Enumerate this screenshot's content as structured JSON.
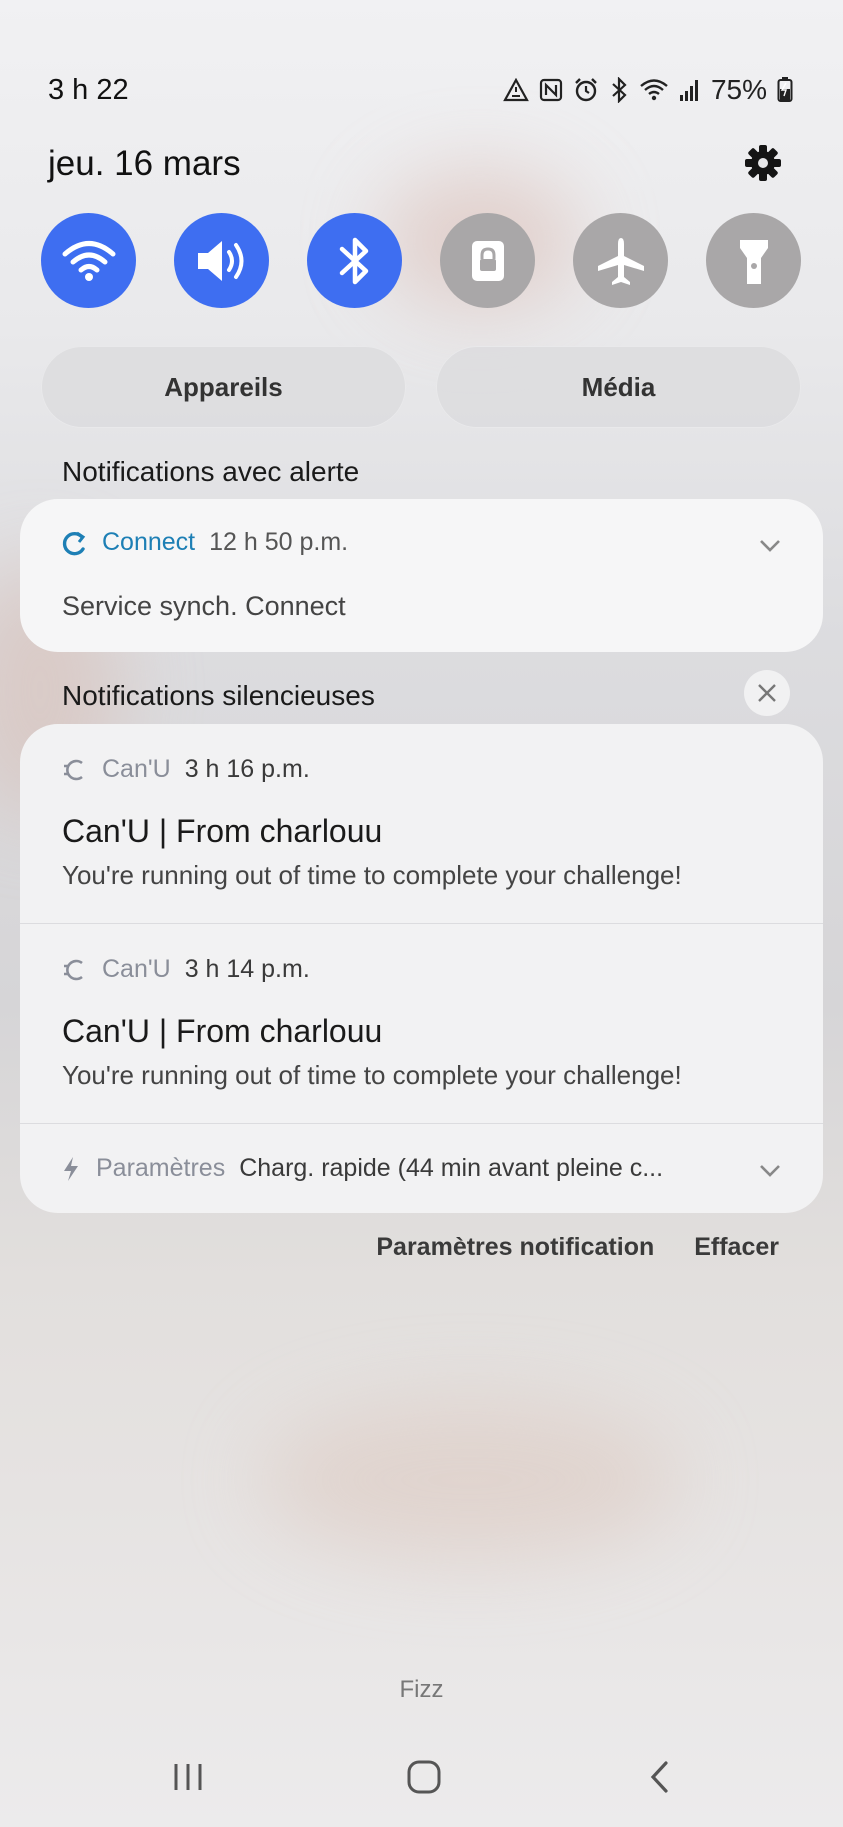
{
  "status_bar": {
    "time": "3 h 22",
    "battery": "75%",
    "icons": [
      "alert-triangle-icon",
      "nfc-icon",
      "alarm-icon",
      "bluetooth-icon",
      "wifi-icon",
      "signal-icon",
      "battery-charging-icon"
    ]
  },
  "date": "jeu. 16 mars",
  "quick_toggles": [
    {
      "name": "wifi",
      "icon": "wifi-icon",
      "state": "on"
    },
    {
      "name": "sound",
      "icon": "volume-icon",
      "state": "on"
    },
    {
      "name": "bluetooth",
      "icon": "bluetooth-icon",
      "state": "on"
    },
    {
      "name": "rotation-lock",
      "icon": "lock-icon",
      "state": "off"
    },
    {
      "name": "airplane",
      "icon": "airplane-icon",
      "state": "off"
    },
    {
      "name": "flashlight",
      "icon": "flashlight-icon",
      "state": "off"
    }
  ],
  "pills": {
    "devices": "Appareils",
    "media": "Média"
  },
  "alert_section": {
    "label": "Notifications avec alerte",
    "notification": {
      "app": "Connect",
      "time": "12 h 50 p.m.",
      "body": "Service synch. Connect"
    }
  },
  "silent_section": {
    "label": "Notifications silencieuses",
    "notifications": [
      {
        "app": "Can'U",
        "time": "3 h 16 p.m.",
        "title": "Can'U | From charlouu",
        "text": "You're running out of time to complete your challenge!"
      },
      {
        "app": "Can'U",
        "time": "3 h 14 p.m.",
        "title": "Can'U | From charlouu",
        "text": "You're running out of time to complete your challenge!"
      }
    ],
    "system": {
      "app": "Paramètres",
      "text": "Charg. rapide (44 min avant pleine c..."
    }
  },
  "actions": {
    "notification_settings": "Paramètres notification",
    "clear": "Effacer"
  },
  "carrier": "Fizz",
  "colors": {
    "accent": "#3e6ef1",
    "toggle_off": "#a9a7a8",
    "connect_blue": "#1d7fb5"
  }
}
